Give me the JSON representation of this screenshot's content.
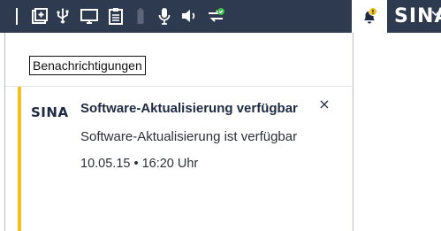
{
  "taskbar": {
    "icons": [
      "add-window-icon",
      "usb-icon",
      "monitor-icon",
      "clipboard-icon",
      "battery-icon",
      "microphone-icon",
      "speaker-icon",
      "network-connected-icon",
      "notification-bell-icon"
    ],
    "brand": "SINA",
    "colors": {
      "bar": "#2e3a4f",
      "alert": "#f2c11b",
      "ok": "#3bbf4a"
    }
  },
  "panel": {
    "title": "Benachrichtigungen",
    "notification": {
      "app_logo": "SINA",
      "title": "Software-Aktualisierung verfügbar",
      "body": "Software-Aktualisierung ist verfügbar",
      "timestamp": "10.05.15 • 16:20 Uhr",
      "close": "×",
      "accent_color": "#f2c11b"
    }
  }
}
